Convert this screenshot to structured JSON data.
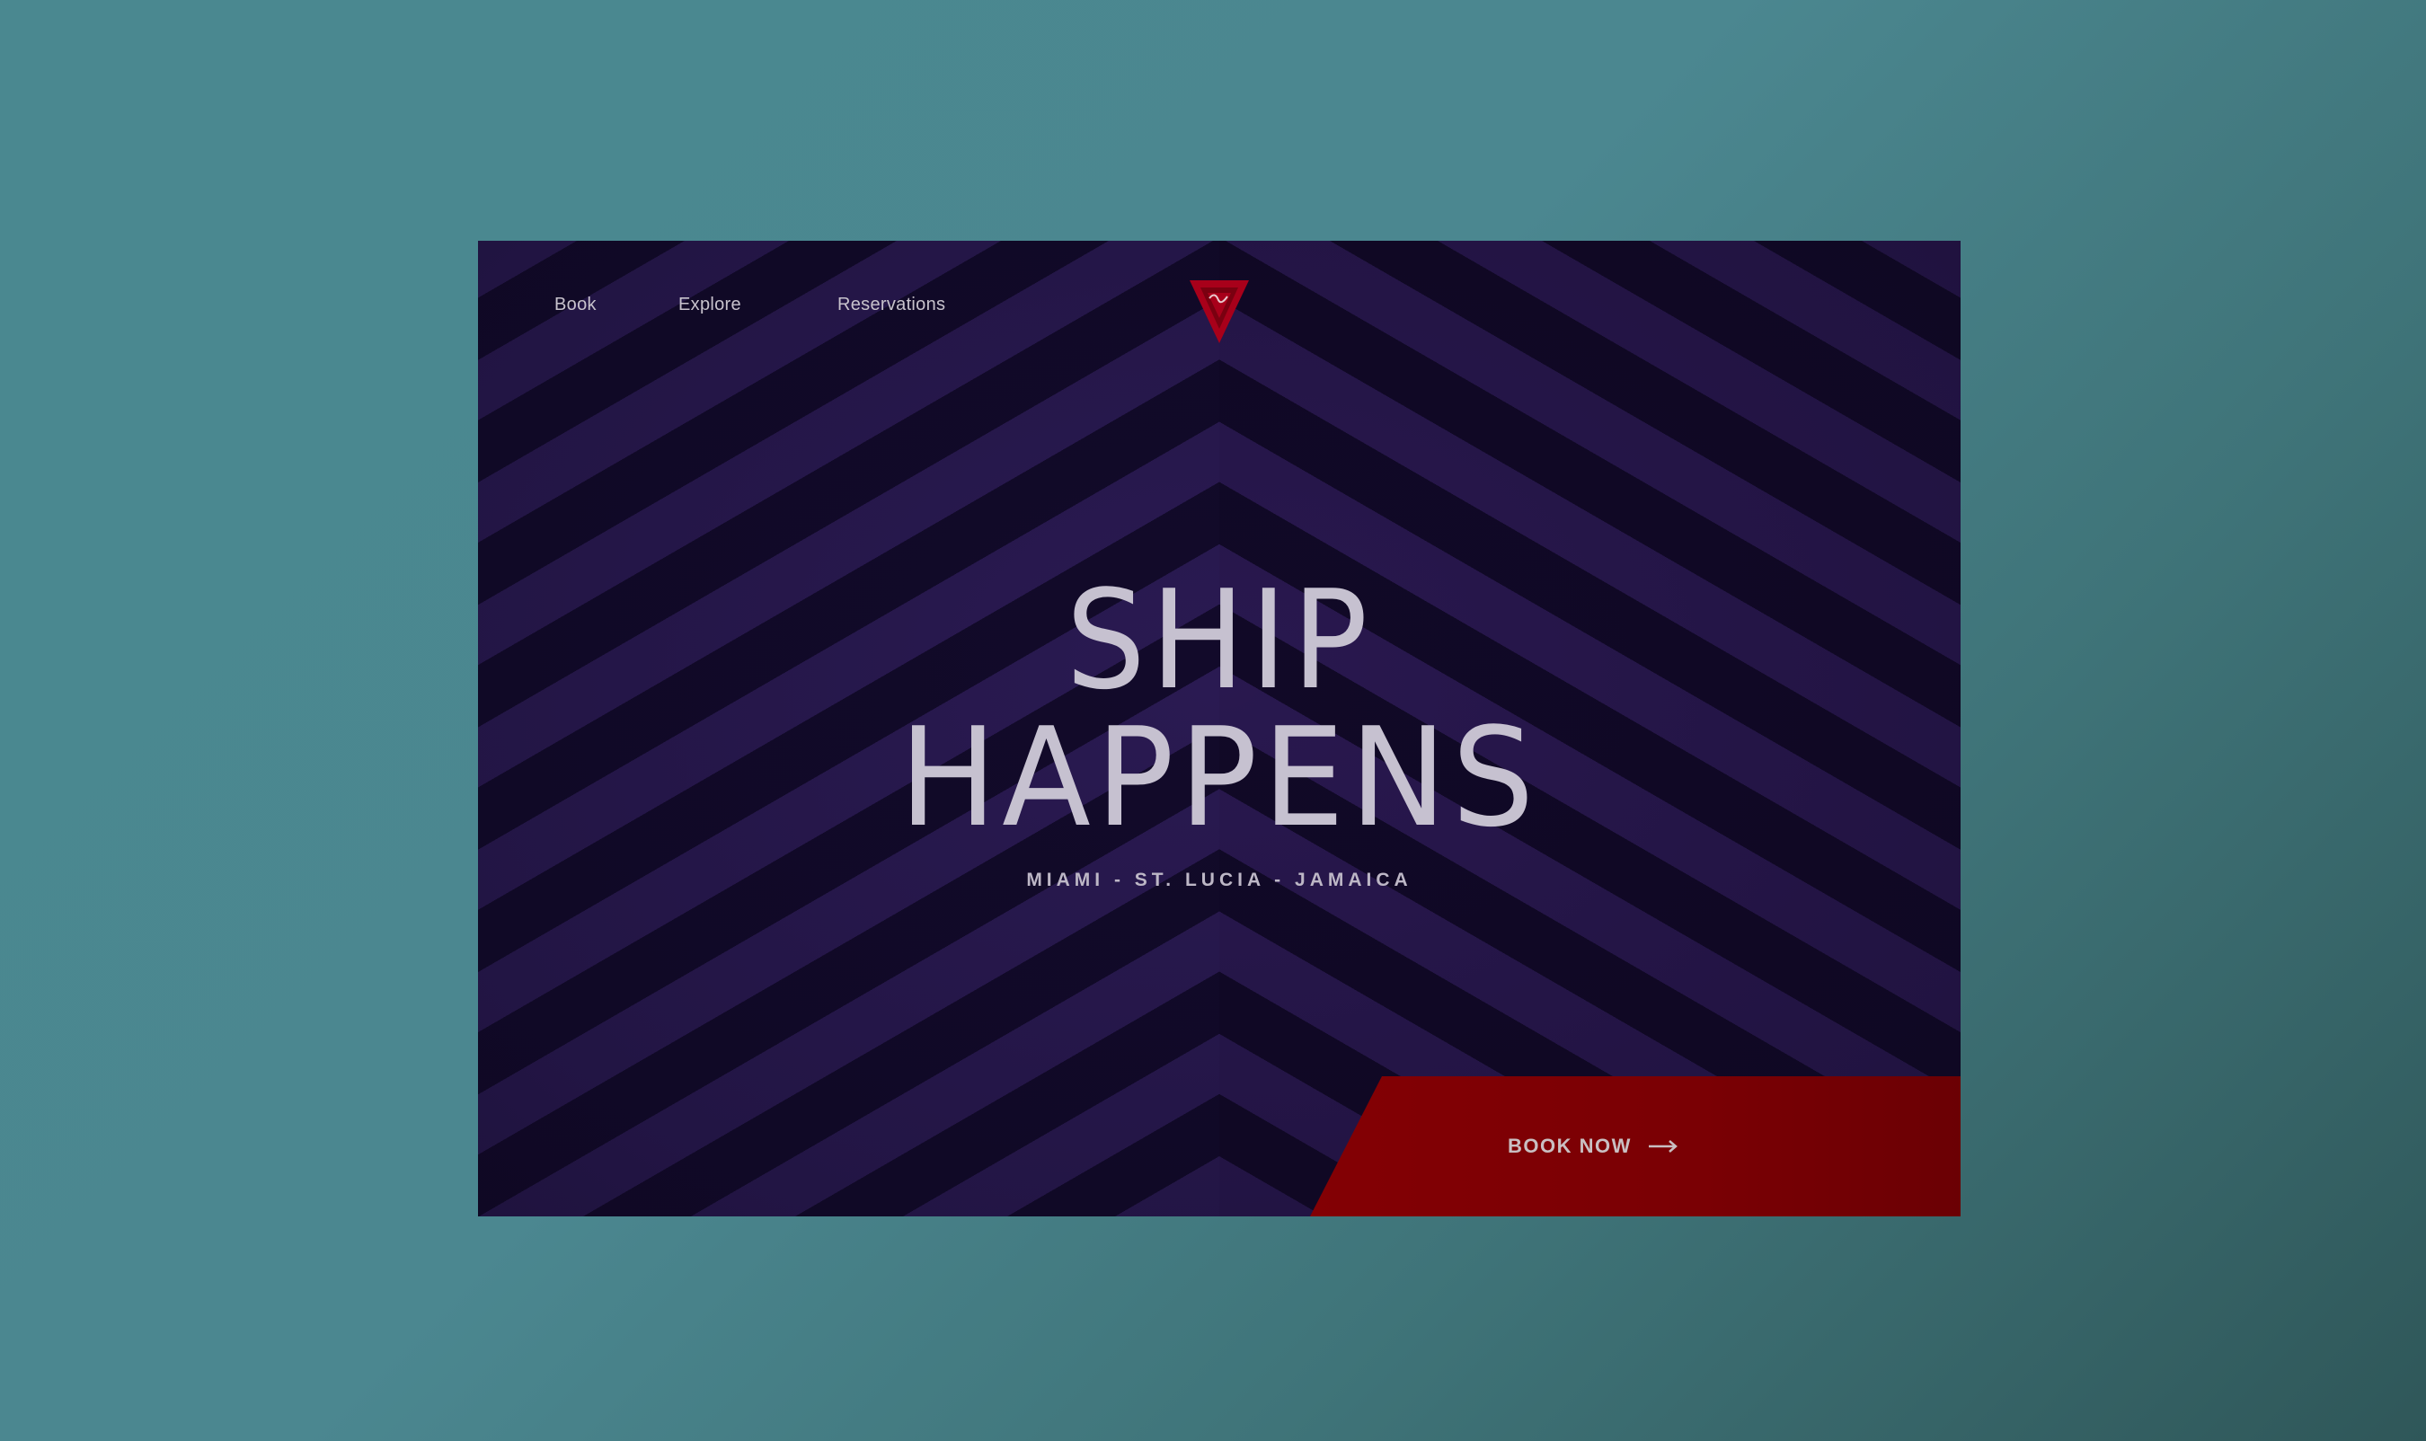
{
  "nav": {
    "items": [
      {
        "label": "Book"
      },
      {
        "label": "Explore"
      },
      {
        "label": "Reservations"
      }
    ]
  },
  "logo": {
    "icon": "brand-triangle-logo",
    "color": "#b0001a"
  },
  "hero": {
    "line1": "SHIP",
    "line2": "HAPPENS",
    "subtitle": "MIAMI - ST. LUCIA - JAMAICA"
  },
  "cta": {
    "label": "BOOK NOW",
    "icon": "arrow-right-icon",
    "color": "#800004"
  },
  "colors": {
    "background": "#4a8890",
    "stripe_light": "#2a1a52",
    "stripe_dark": "#120a2a",
    "text": "#c6c1d0"
  }
}
